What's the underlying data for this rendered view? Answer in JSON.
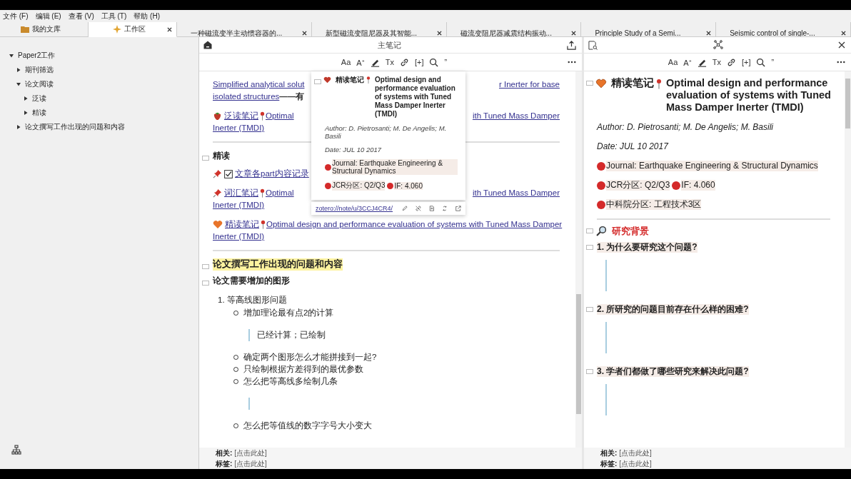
{
  "menu": [
    "文件 (F)",
    "编辑 (E)",
    "查看 (V)",
    "工具 (T)",
    "帮助 (H)"
  ],
  "tabs": [
    {
      "label": "我的文库",
      "kind": "library",
      "selected": false,
      "closable": false
    },
    {
      "label": "工作区",
      "kind": "workspace",
      "selected": true,
      "closable": true
    },
    {
      "label": "一种磁流变半主动惯容器的...",
      "kind": "doc",
      "selected": false,
      "closable": true
    },
    {
      "label": "新型磁流变阻尼器及其智能...",
      "kind": "doc",
      "selected": false,
      "closable": true
    },
    {
      "label": "磁流变阻尼器减震结构振动...",
      "kind": "doc",
      "selected": false,
      "closable": true
    },
    {
      "label": "Principle Study of a Semi...",
      "kind": "doc",
      "selected": false,
      "closable": true
    },
    {
      "label": "Seismic control of single-...",
      "kind": "doc",
      "selected": false,
      "closable": true
    }
  ],
  "sidebar": {
    "tree": [
      {
        "label": "Paper2工作",
        "expanded": true,
        "children": [
          {
            "label": "期刊筛选",
            "expanded": false
          },
          {
            "label": "论文阅读",
            "expanded": true,
            "children": [
              {
                "label": "泛读",
                "expanded": false
              },
              {
                "label": "精读",
                "expanded": false
              }
            ]
          },
          {
            "label": "论文撰写工作出现的问题和内容",
            "expanded": false
          }
        ]
      }
    ]
  },
  "main_note": {
    "title": "主笔记",
    "toolbar": [
      {
        "kind": "text",
        "label": "Aa"
      },
      {
        "kind": "text",
        "label": "A⁺"
      },
      {
        "kind": "highlighter"
      },
      {
        "kind": "text",
        "label": "Tx"
      },
      {
        "kind": "link"
      },
      {
        "kind": "text",
        "label": "[+]"
      },
      {
        "kind": "search"
      },
      {
        "kind": "text",
        "label": "”"
      }
    ],
    "blocks": [
      {
        "kind": "link",
        "lines": [
          {
            "left": "Simplified analytical solut",
            "right": "r Inerter for base"
          },
          {
            "left": "isolated structures",
            "tail": "——有"
          }
        ]
      },
      {
        "kind": "skim_note",
        "label": "泛读笔记",
        "lines": [
          {
            "left": "Optimal",
            "right": "ith Tuned Mass Damper"
          },
          {
            "left": "Inerter (TMDI)"
          }
        ]
      },
      {
        "kind": "rule"
      },
      {
        "kind": "heading2",
        "text": "精读"
      },
      {
        "kind": "task",
        "label": "文章各part内容记录"
      },
      {
        "kind": "vocab_note",
        "label": "词汇笔记",
        "lines": [
          {
            "left": "Optimal",
            "right": "ith Tuned Mass Damper"
          },
          {
            "left": "Inerter (TMDI)"
          }
        ]
      },
      {
        "kind": "close_note",
        "label": "精读笔记",
        "lines": [
          {
            "left": "Optimal design and performance evaluation of systems with Tuned Mass Damper"
          },
          {
            "left": "Inerter (TMDI)"
          }
        ]
      },
      {
        "kind": "rule"
      },
      {
        "kind": "heading1",
        "text": "论文撰写工作出现的问题和内容"
      },
      {
        "kind": "heading2",
        "text": "论文需要增加的图形"
      },
      {
        "kind": "numbered",
        "number": "1.",
        "text": "等高线图形问题"
      },
      {
        "kind": "bullet",
        "text": "增加理论最有点2的计算"
      },
      {
        "kind": "quote",
        "text": "已经计算；已绘制"
      },
      {
        "kind": "bullet",
        "text": "确定两个图形怎么才能拼接到一起?"
      },
      {
        "kind": "bullet",
        "text": "只绘制根据方差得到的最优参数"
      },
      {
        "kind": "bullet",
        "text": "怎么把等高线多绘制几条"
      },
      {
        "kind": "quote"
      },
      {
        "kind": "bullet",
        "text": "怎么把等值线的数字字号大小变大"
      }
    ],
    "popup": {
      "label": "精读笔记",
      "title": "Optimal design and performance evaluation of systems with Tuned Mass Damper Inerter (TMDI)",
      "lines": [
        {
          "kind": "italic",
          "text": "Author: D. Pietrosanti; M. De Angelis; M. Basili"
        },
        {
          "kind": "italic",
          "text": "Date: JUL 10 2017"
        },
        {
          "kind": "dots",
          "items": [
            "Journal: Earthquake Engineering & Structural Dynamics"
          ]
        },
        {
          "kind": "dots",
          "items": [
            "JCR分区: Q2/Q3",
            "IF: 4.060"
          ]
        }
      ],
      "link": "zotero://note/u/3CCJ4CR4/"
    },
    "footer": [
      {
        "label": "相关:",
        "value": "[点击此处]"
      },
      {
        "label": "标签:",
        "value": "[点击此处]"
      }
    ]
  },
  "side_note": {
    "toolbar": [
      {
        "kind": "text",
        "label": "Aa"
      },
      {
        "kind": "text",
        "label": "A⁺"
      },
      {
        "kind": "highlighter"
      },
      {
        "kind": "text",
        "label": "Tx"
      },
      {
        "kind": "link"
      },
      {
        "kind": "text",
        "label": "[+]"
      },
      {
        "kind": "search"
      },
      {
        "kind": "text",
        "label": "”"
      }
    ],
    "label": "精读笔记",
    "title": "Optimal design and performance evaluation of systems with Tuned Mass Damper Inerter (TMDI)",
    "blocks": [
      {
        "kind": "italic",
        "text": "Author: D. Pietrosanti; M. De Angelis; M. Basili"
      },
      {
        "kind": "italic",
        "text": "Date: JUL 10 2017"
      },
      {
        "kind": "dots",
        "items": [
          "Journal: Earthquake Engineering & Structural Dynamics"
        ]
      },
      {
        "kind": "dots",
        "items": [
          "JCR分区: Q2/Q3",
          "IF: 4.060"
        ]
      },
      {
        "kind": "dots",
        "items": [
          "中科院分区: 工程技术3区"
        ]
      },
      {
        "kind": "rule"
      },
      {
        "kind": "section",
        "text": "研究背景"
      },
      {
        "kind": "question",
        "text": "1. 为什么要研究这个问题?"
      },
      {
        "kind": "quote"
      },
      {
        "kind": "question",
        "text": "2. 所研究的问题目前存在什么样的困难?"
      },
      {
        "kind": "quote"
      },
      {
        "kind": "question",
        "text": "3. 学者们都做了哪些研究来解决此问题?"
      },
      {
        "kind": "quote"
      }
    ],
    "footer": [
      {
        "label": "相关:",
        "value": "[点击此处]"
      },
      {
        "label": "标签:",
        "value": "[点击此处]"
      }
    ]
  }
}
